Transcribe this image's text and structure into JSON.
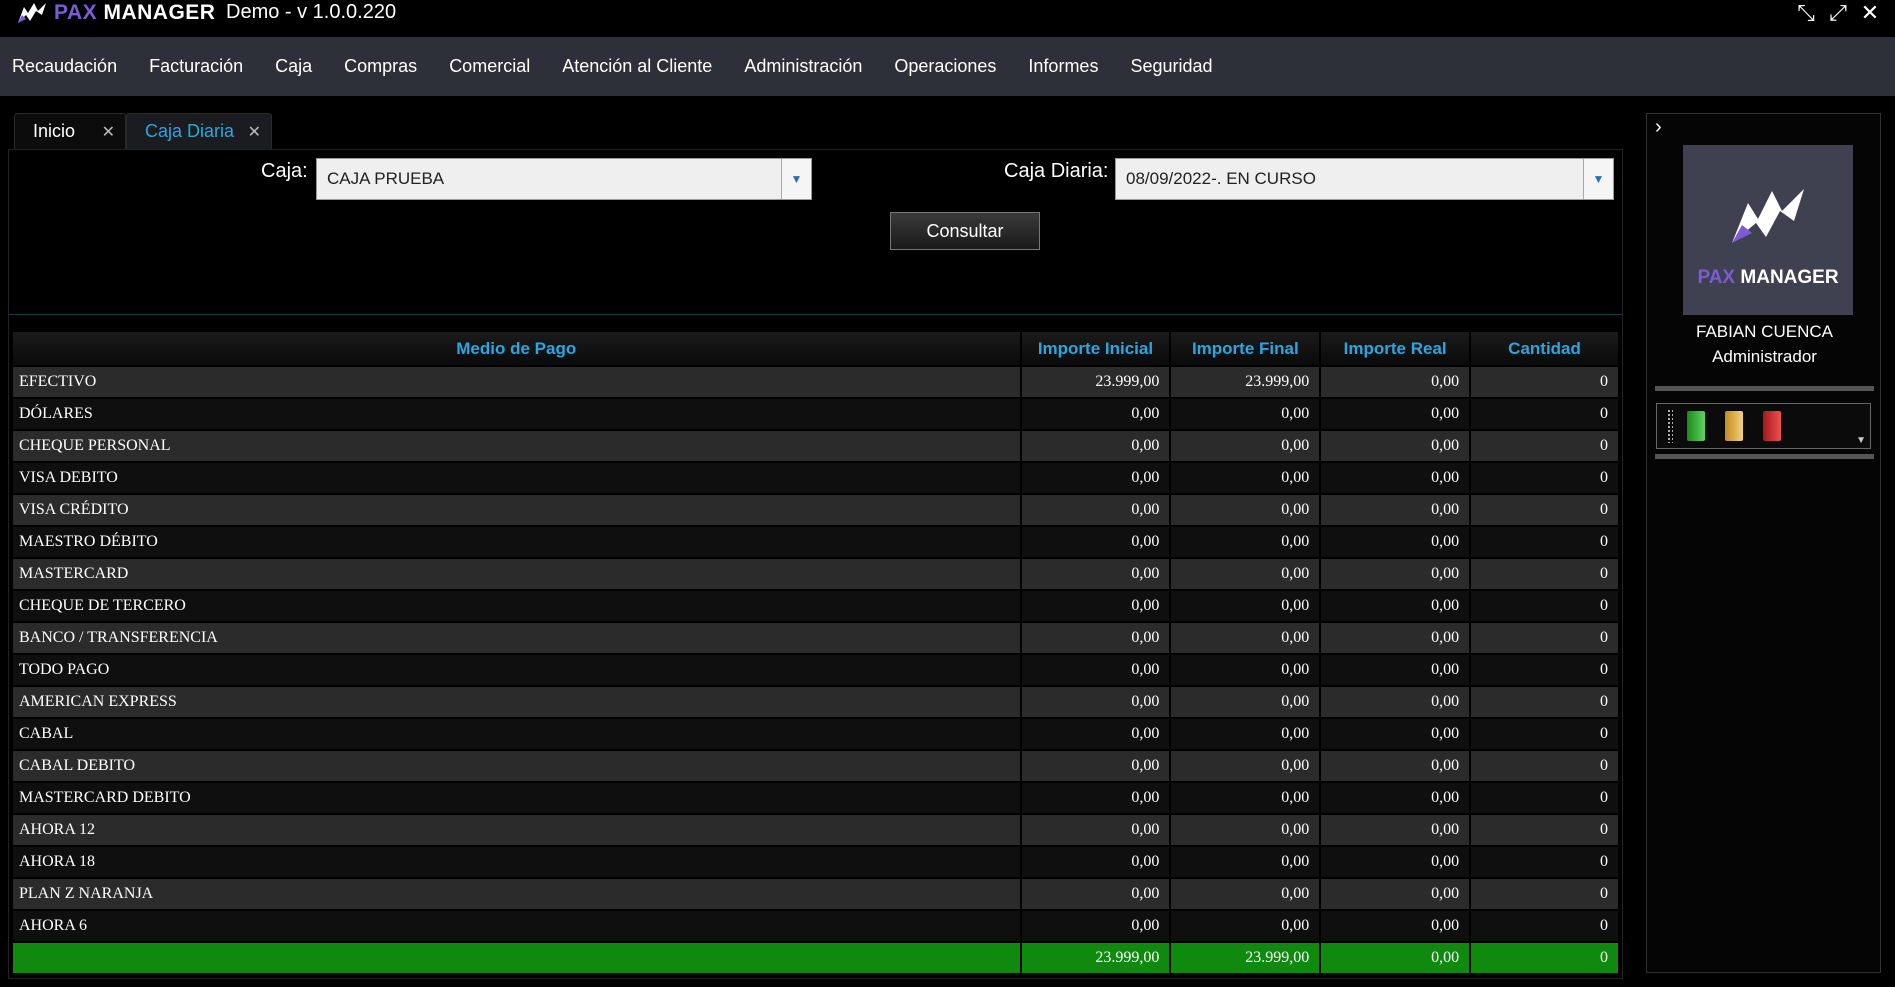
{
  "app": {
    "brand_pax": "PAX",
    "brand_manager": "MANAGER",
    "title": "Demo - v 1.0.0.220"
  },
  "menu": [
    "Recaudación",
    "Facturación",
    "Caja",
    "Compras",
    "Comercial",
    "Atención al Cliente",
    "Administración",
    "Operaciones",
    "Informes",
    "Seguridad"
  ],
  "tabs": [
    {
      "label": "Inicio",
      "active": false
    },
    {
      "label": "Caja Diaria",
      "active": true
    }
  ],
  "filters": {
    "caja_label": "Caja:",
    "caja_value": "CAJA PRUEBA",
    "caja_diaria_label": "Caja Diaria:",
    "caja_diaria_value": "08/09/2022-. EN CURSO",
    "consultar_label": "Consultar"
  },
  "table": {
    "columns": [
      "Medio de Pago",
      "Importe Inicial",
      "Importe Final",
      "Importe Real",
      "Cantidad"
    ],
    "rows": [
      [
        "EFECTIVO",
        "23.999,00",
        "23.999,00",
        "0,00",
        "0"
      ],
      [
        "DÓLARES",
        "0,00",
        "0,00",
        "0,00",
        "0"
      ],
      [
        "CHEQUE PERSONAL",
        "0,00",
        "0,00",
        "0,00",
        "0"
      ],
      [
        "VISA DEBITO",
        "0,00",
        "0,00",
        "0,00",
        "0"
      ],
      [
        "VISA CRÉDITO",
        "0,00",
        "0,00",
        "0,00",
        "0"
      ],
      [
        "MAESTRO DÉBITO",
        "0,00",
        "0,00",
        "0,00",
        "0"
      ],
      [
        "MASTERCARD",
        "0,00",
        "0,00",
        "0,00",
        "0"
      ],
      [
        "CHEQUE DE TERCERO",
        "0,00",
        "0,00",
        "0,00",
        "0"
      ],
      [
        "BANCO / TRANSFERENCIA",
        "0,00",
        "0,00",
        "0,00",
        "0"
      ],
      [
        "TODO PAGO",
        "0,00",
        "0,00",
        "0,00",
        "0"
      ],
      [
        "AMERICAN EXPRESS",
        "0,00",
        "0,00",
        "0,00",
        "0"
      ],
      [
        "CABAL",
        "0,00",
        "0,00",
        "0,00",
        "0"
      ],
      [
        "CABAL DEBITO",
        "0,00",
        "0,00",
        "0,00",
        "0"
      ],
      [
        "MASTERCARD DEBITO",
        "0,00",
        "0,00",
        "0,00",
        "0"
      ],
      [
        "AHORA 12",
        "0,00",
        "0,00",
        "0,00",
        "0"
      ],
      [
        "AHORA 18",
        "0,00",
        "0,00",
        "0,00",
        "0"
      ],
      [
        "PLAN Z NARANJA",
        "0,00",
        "0,00",
        "0,00",
        "0"
      ],
      [
        "AHORA 6",
        "0,00",
        "0,00",
        "0,00",
        "0"
      ]
    ],
    "totals": [
      "",
      "23.999,00",
      "23.999,00",
      "0,00",
      "0"
    ]
  },
  "side": {
    "user_name": "FABIAN CUENCA",
    "user_role": "Administrador",
    "tools": [
      "green-book-icon",
      "yellow-book-icon",
      "red-book-icon"
    ]
  },
  "colors": {
    "accent_blue": "#2aa6e0",
    "menu_bg": "#2d3038",
    "total_green": "#0f8a0f",
    "brand_purple": "#7b5cd6"
  }
}
